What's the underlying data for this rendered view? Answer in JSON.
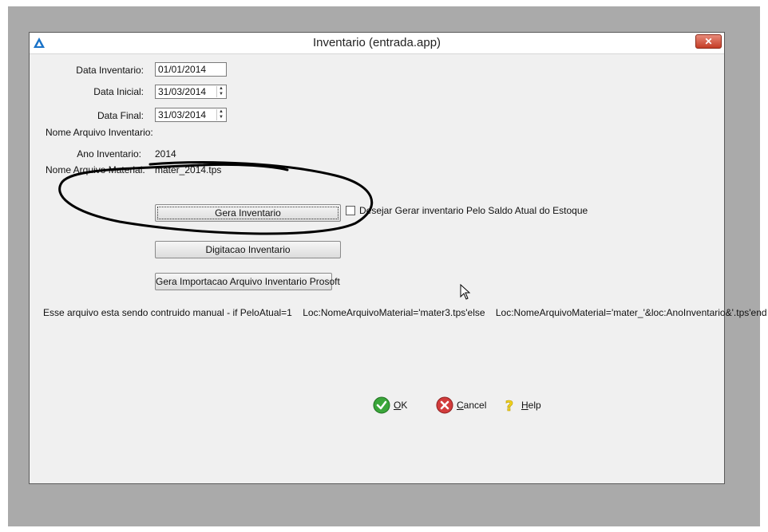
{
  "window": {
    "title": "Inventario (entrada.app)",
    "close_glyph": "✕"
  },
  "form": {
    "data_inventario": {
      "label": "Data Inventario:",
      "value": "01/01/2014"
    },
    "data_inicial": {
      "label": "Data Inicial:",
      "value": "31/03/2014"
    },
    "data_final": {
      "label": "Data Final:",
      "value": "31/03/2014"
    },
    "nome_arquivo_inventario": {
      "label": "Nome Arquivo Inventario:"
    },
    "ano_inventario": {
      "label": "Ano Inventario:",
      "value": "2014"
    },
    "nome_arquivo_material": {
      "label": "Nome Arquivo Material:",
      "value": "mater_2014.tps"
    }
  },
  "buttons": {
    "gera_inventario": "Gera Inventario",
    "digitacao_inventario": "Digitacao Inventario",
    "gera_importacao": "Gera Importacao Arquivo Inventario Prosoft"
  },
  "checkbox": {
    "label": "Desejar Gerar inventario Pelo Saldo Atual do Estoque",
    "checked": false
  },
  "info_text": "Esse arquivo esta sendo contruido manual - if PeloAtual=1    Loc:NomeArquivoMaterial='mater3.tps'else    Loc:NomeArquivoMaterial='mater_'&loc:AnoInventario&'.tps'end",
  "actions": {
    "ok": {
      "underline": "O",
      "rest": "K",
      "icon": "check-icon"
    },
    "cancel": {
      "underline": "C",
      "rest": "ancel",
      "icon": "cancel-icon"
    },
    "help": {
      "underline": "H",
      "rest": "elp",
      "icon": "help-icon"
    }
  },
  "colors": {
    "ok_green": "#3aa63a",
    "cancel_red": "#d23c3c",
    "help_yellow": "#f2d21c",
    "app_icon_blue": "#1a73c8"
  }
}
